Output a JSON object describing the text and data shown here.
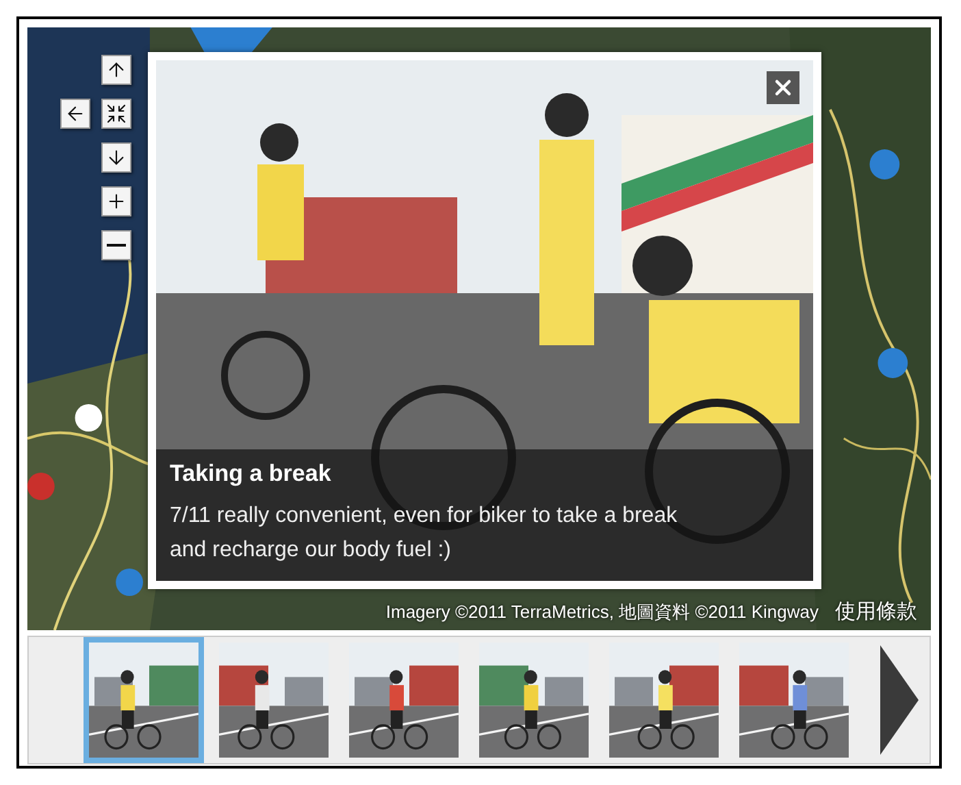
{
  "map": {
    "kind": "picture",
    "controls": [
      {
        "kind": "up"
      },
      {
        "kind": "left"
      },
      {
        "kind": "center"
      },
      {
        "kind": "down"
      },
      {
        "kind": "zoom_in"
      },
      {
        "kind": "zoom_out"
      }
    ],
    "attribution": "Imagery ©2011 TerraMetrics, 地圖資料 ©2011 Kingway",
    "terms_link": "使用條款"
  },
  "popup": {
    "photo": {
      "kind": "picture"
    },
    "title": "Taking a break",
    "description": "7/11 really convenient, even for biker to take a break and recharge our body fuel :)"
  },
  "thumbnails": [
    {
      "kind": "picture",
      "selected": true
    },
    {
      "kind": "picture",
      "selected": false
    },
    {
      "kind": "picture",
      "selected": false
    },
    {
      "kind": "picture",
      "selected": false
    },
    {
      "kind": "picture",
      "selected": false
    },
    {
      "kind": "picture",
      "selected": false
    }
  ]
}
